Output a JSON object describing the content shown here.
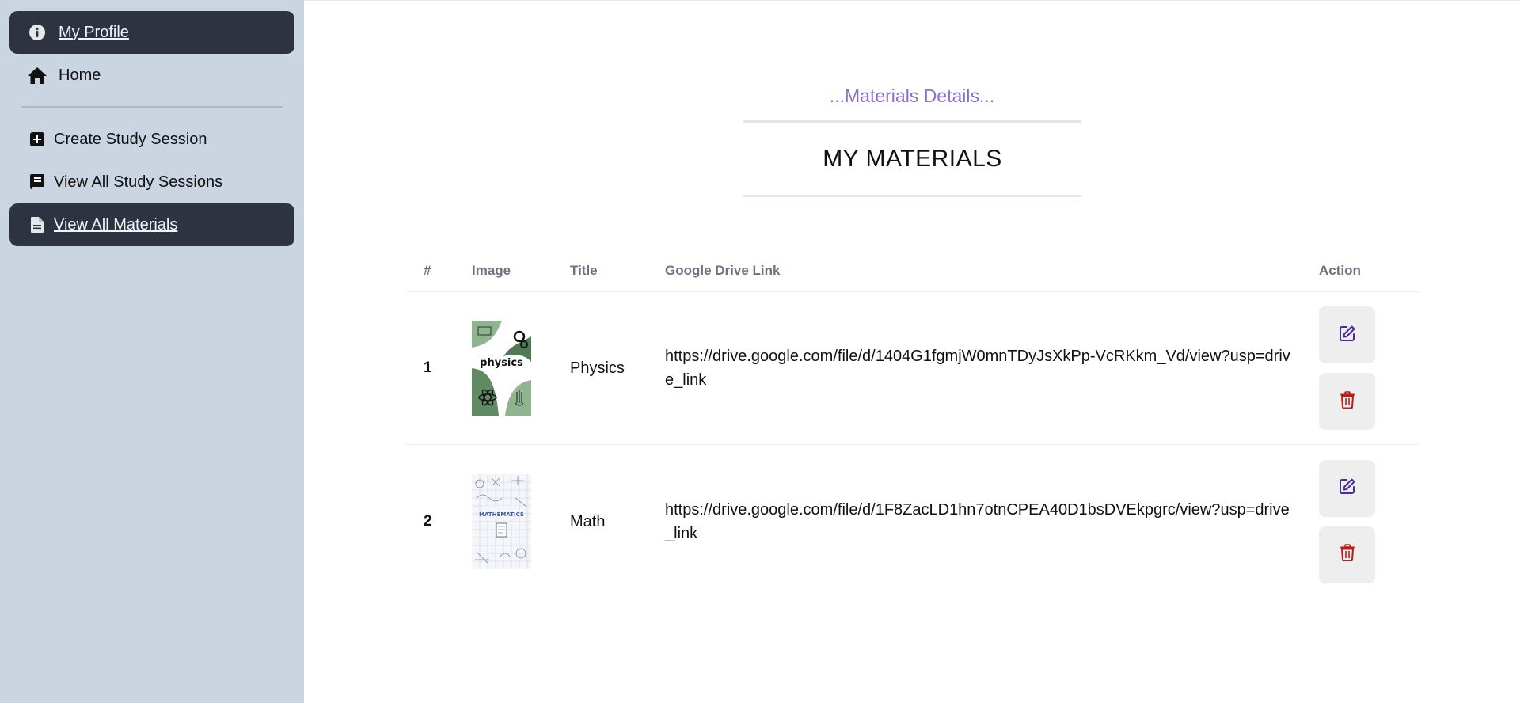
{
  "sidebar": {
    "items": [
      {
        "label": "My Profile",
        "icon": "info-icon",
        "active": true
      },
      {
        "label": "Home",
        "icon": "home-icon",
        "active": false
      },
      {
        "label": "Create Study Session",
        "icon": "plus-square-icon",
        "active": false
      },
      {
        "label": "View All Study Sessions",
        "icon": "book-icon",
        "active": false
      },
      {
        "label": "View All Materials",
        "icon": "document-icon",
        "active": true
      }
    ]
  },
  "main": {
    "subtitle": "...Materials Details...",
    "title": "MY MATERIALS",
    "table": {
      "headers": {
        "num": "#",
        "image": "Image",
        "title": "Title",
        "link": "Google Drive Link",
        "action": "Action"
      },
      "rows": [
        {
          "num": "1",
          "title": "Physics",
          "link": "https://drive.google.com/file/d/1404G1fgmjW0mnTDyJsXkPp-VcRKkm_Vd/view?usp=drive_link",
          "thumb_text": "physics"
        },
        {
          "num": "2",
          "title": "Math",
          "link": "https://drive.google.com/file/d/1F8ZacLD1hn7otnCPEA40D1bsDVEkpgrc/view?usp=drive_link",
          "thumb_text": "MATHEMATICS"
        }
      ]
    }
  },
  "colors": {
    "sidebar_bg": "#cbd5e1",
    "active_bg": "#2d3340",
    "subtitle": "#8a6fcc",
    "edit_icon": "#4c2c9e",
    "delete_icon": "#b91c1c"
  }
}
